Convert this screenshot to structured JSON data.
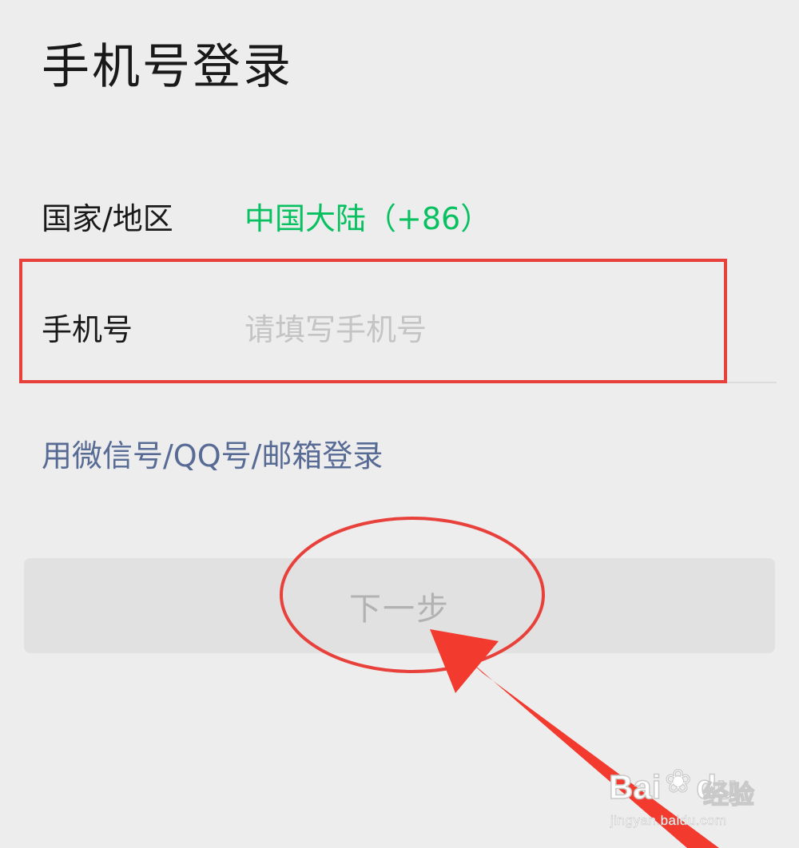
{
  "page": {
    "title": "手机号登录"
  },
  "form": {
    "country_label": "国家/地区",
    "country_value": "中国大陆（+86）",
    "phone_label": "手机号",
    "phone_value": "",
    "phone_placeholder": "请填写手机号"
  },
  "links": {
    "alt_login": "用微信号/QQ号/邮箱登录"
  },
  "actions": {
    "next_label": "下一步",
    "next_enabled": false
  },
  "colors": {
    "background": "#ededed",
    "accent_green": "#07c160",
    "link_blue": "#576b95",
    "annotation_red": "#e8413c",
    "disabled_button": "#e1e1e1"
  },
  "annotations": {
    "shapes": [
      "highlight-rectangle",
      "highlight-ellipse",
      "pointer-arrow"
    ]
  },
  "watermark": {
    "logo_text": "Bai",
    "logo_icon": "paw-icon",
    "brand_text": "经验",
    "url_text": "jingyan.baidu.com"
  }
}
